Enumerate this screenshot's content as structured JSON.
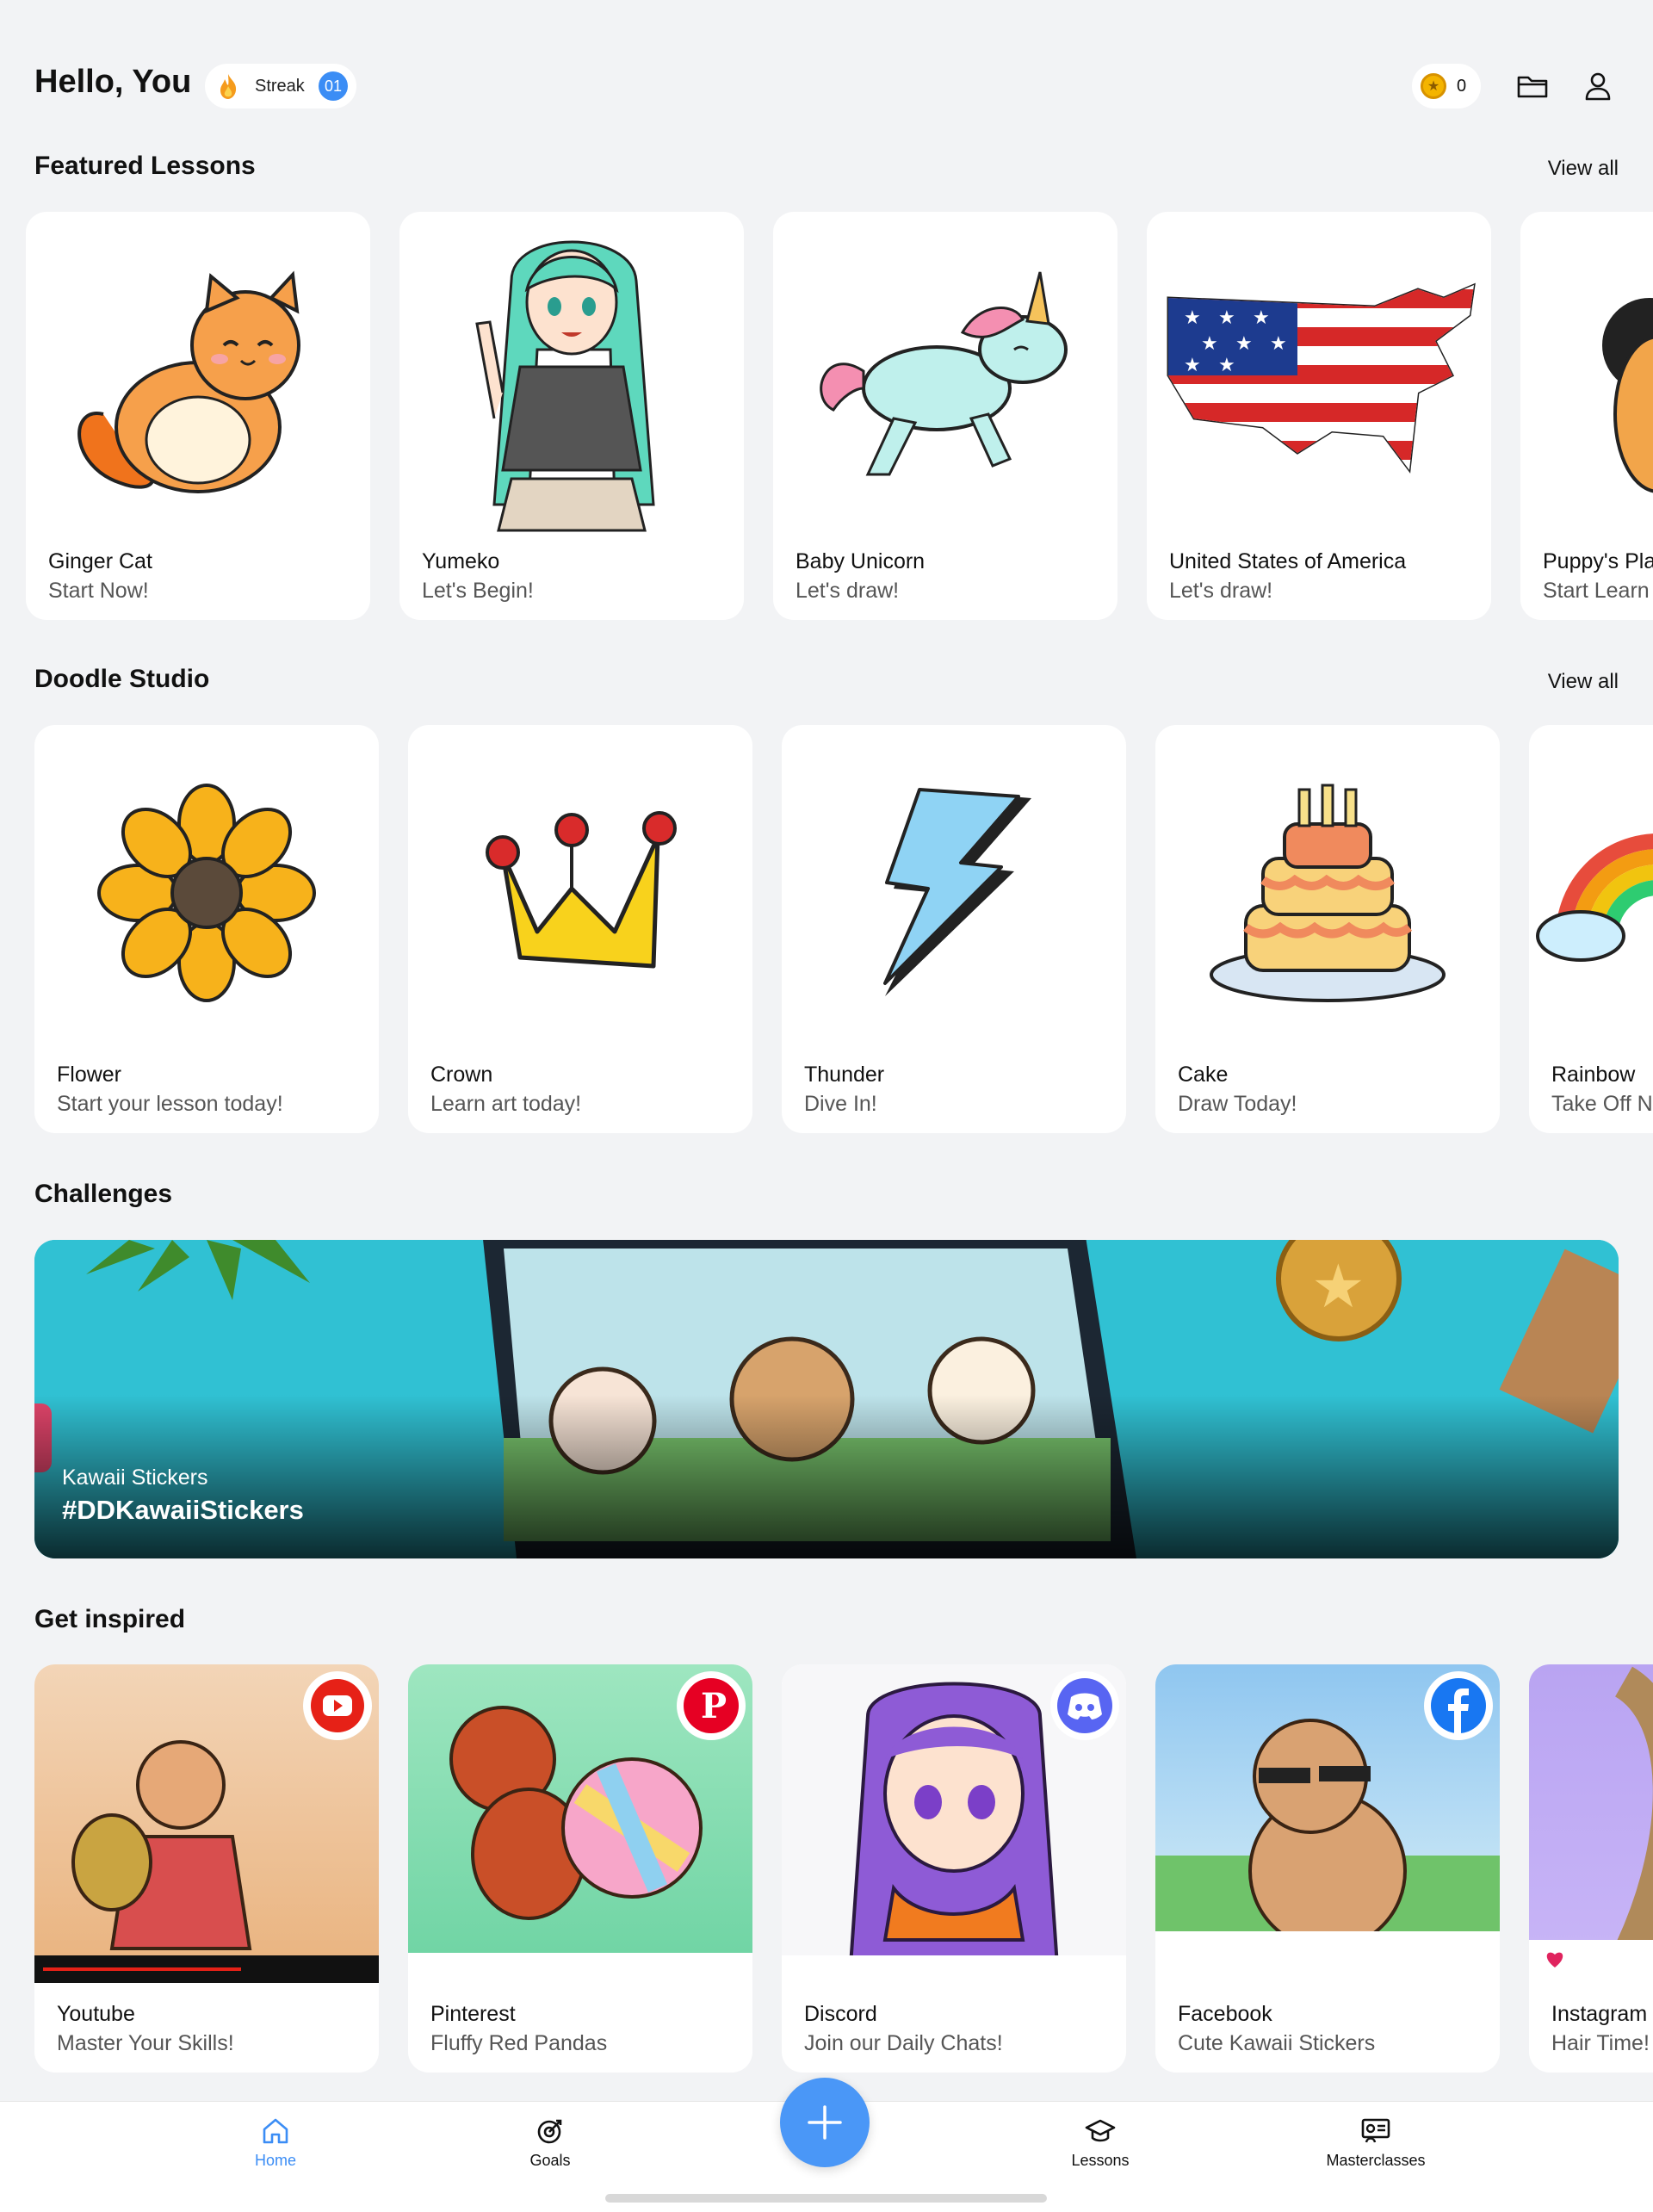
{
  "header": {
    "greeting": "Hello, You",
    "streak_label": "Streak",
    "streak_count": "01",
    "coins": "0",
    "icons": [
      "coin-icon",
      "folder-icon",
      "profile-icon"
    ]
  },
  "featured": {
    "title": "Featured Lessons",
    "view_all": "View all",
    "items": [
      {
        "title": "Ginger Cat",
        "subtitle": "Start Now!"
      },
      {
        "title": "Yumeko",
        "subtitle": "Let's Begin!"
      },
      {
        "title": "Baby Unicorn",
        "subtitle": "Let's draw!"
      },
      {
        "title": "United States of America",
        "subtitle": "Let's draw!"
      },
      {
        "title": "Puppy's Pla",
        "subtitle": "Start Learn"
      }
    ]
  },
  "doodle": {
    "title": "Doodle Studio",
    "view_all": "View all",
    "items": [
      {
        "title": "Flower",
        "subtitle": "Start your lesson today!"
      },
      {
        "title": "Crown",
        "subtitle": "Learn art today!"
      },
      {
        "title": "Thunder",
        "subtitle": "Dive In!"
      },
      {
        "title": "Cake",
        "subtitle": "Draw Today!"
      },
      {
        "title": "Rainbow",
        "subtitle": "Take Off N"
      }
    ]
  },
  "challenges": {
    "title": "Challenges",
    "banner_label": "Kawaii Stickers",
    "banner_tag": "#DDKawaiiStickers"
  },
  "inspired": {
    "title": "Get inspired",
    "items": [
      {
        "title": "Youtube",
        "subtitle": "Master Your Skills!",
        "icon": "youtube-icon",
        "color": "#ff0000"
      },
      {
        "title": "Pinterest",
        "subtitle": "Fluffy Red Pandas",
        "icon": "pinterest-icon",
        "color": "#e60023"
      },
      {
        "title": "Discord",
        "subtitle": "Join our Daily Chats!",
        "icon": "discord-icon",
        "color": "#5865f2"
      },
      {
        "title": "Facebook",
        "subtitle": "Cute Kawaii Stickers",
        "icon": "facebook-icon",
        "color": "#1877f2"
      },
      {
        "title": "Instagram",
        "subtitle": "Hair Time!",
        "icon": "instagram-icon",
        "color": "#c13584"
      }
    ]
  },
  "nav": {
    "items": [
      {
        "label": "Home",
        "icon": "home-icon",
        "active": true
      },
      {
        "label": "Goals",
        "icon": "goals-icon"
      },
      {
        "label": "Lessons",
        "icon": "lessons-icon"
      },
      {
        "label": "Masterclasses",
        "icon": "masterclasses-icon"
      }
    ],
    "fab_icon": "plus-icon",
    "active_color": "#3b8df5"
  }
}
